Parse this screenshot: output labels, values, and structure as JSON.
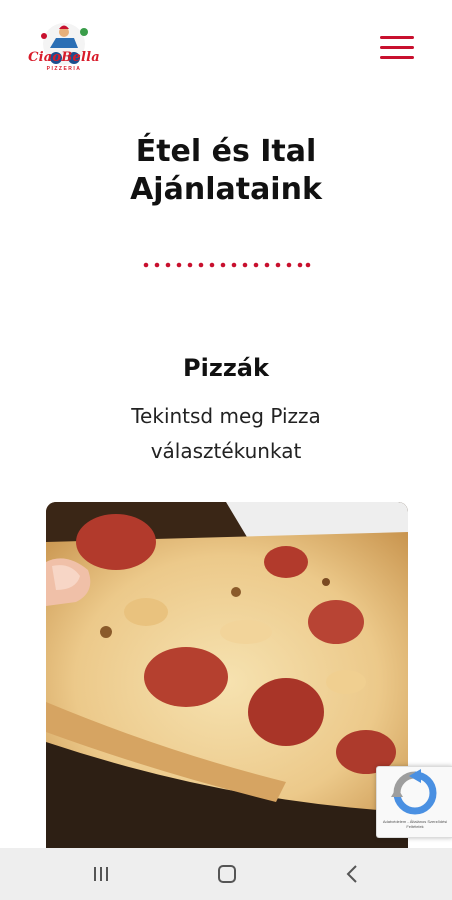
{
  "header": {
    "logo_text": "CiaoBella",
    "logo_subtext": "PIZZERIA",
    "menu_icon": "hamburger-menu-icon",
    "accent_color": "#c8102e"
  },
  "main": {
    "title": "Étel és Ital Ajánlataink",
    "section": {
      "title": "Pizzák",
      "description": "Tekintsd meg Pizza választékunkat",
      "image": "pizza-slice-photo"
    }
  },
  "recaptcha": {
    "icon": "recaptcha-icon",
    "text": "Adatvédelem - Általános Szerződési Feltételek"
  },
  "system_nav": {
    "recents_icon": "recents-icon",
    "home_icon": "home-icon",
    "back_icon": "back-icon"
  }
}
